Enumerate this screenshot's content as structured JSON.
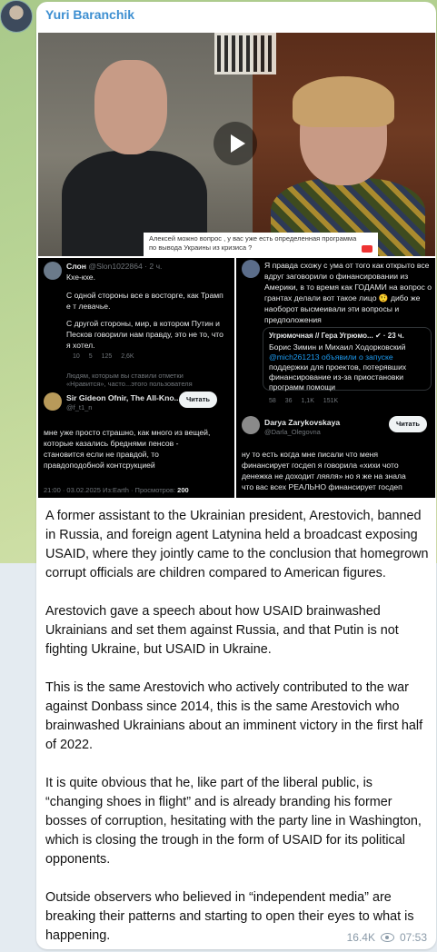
{
  "post": {
    "author": "Yuri Baranchik",
    "views": "16.4K",
    "time": "07:53",
    "paragraphs": [
      "A former assistant to the Ukrainian president, Arestovich, banned in Russia, and foreign agent Latynina held a broadcast exposing USAID, where they jointly came to the conclusion that homegrown corrupt officials are children compared to American figures.",
      "Arestovich gave a speech about how USAID brainwashed Ukrainians and set them against Russia, and that Putin is not fighting Ukraine, but USAID in Ukraine.",
      "This is the same Arestovich who actively contributed to the war against Donbass since 2014, this is the same Arestovich who brainwashed Ukrainians about an imminent victory in the first half of 2022.",
      "It is quite obvious that he, like part of the liberal public, is “changing shoes in flight” and is already branding his former bosses of corruption, hesitating with the party line in Washington, which is closing the trough in the form of USAID for its political opponents.",
      "Outside observers who believed in “independent media” are breaking their patterns and starting to open their eyes to what is happening."
    ]
  },
  "video": {
    "caption_line1": "Алексей можно вопрос , у вас уже есть определенная программа",
    "caption_line2": "по вывода Украины из кризиса ?"
  },
  "shot_left": {
    "name": "Слон",
    "handle": "@Slon1022864 · 2 ч.",
    "line1": "Кхе-кхе.",
    "line2": "С одной стороны все в восторге, как Трамп",
    "line3": "е     т левачье.",
    "line4": "С другой стороны, мир, в котором Путин и",
    "line5": "Песков говорили нам правду, это не то, что",
    "line6": "я хотел.",
    "stats": "10 5 125 2,6K",
    "liked_note1": "Людям, которым вы ставили отметки",
    "liked_note2": "«Нравится», часто...этого пользователя",
    "reply_name": "Sir Gideon Ofnir, The All-Kno...",
    "reply_handle": "@f_t1_n",
    "read_button": "Читать",
    "reply1": "мне уже просто страшно, как много из вещей,",
    "reply2": "которые казались бреднями пенсов -",
    "reply3": "становится если не правдой, то",
    "reply4": "правдоподобной контсрукцией",
    "footer_time": "21:00 · 03.02.2025 Из:Earth · Просмотров:",
    "footer_views": "200"
  },
  "shot_right": {
    "line1": "Я правда схожу с ума от того как открыто все",
    "line2": "вдруг заговорили о финансировании из",
    "line3": "Америки, в то время как ГОДАМИ на вопрос о",
    "line4": "грантах делали вот такое лицо 🤨 дибо же",
    "line5": "наоборот высмеивали эти вопросы и",
    "line6": "предположения",
    "quote_name": "Угрюмочная // Гера Угрюмо... ✔ · 23 ч.",
    "quote1": "Борис Зимин и Михаил Ходорковский",
    "quote2": "@mich261213 объявили о запуске",
    "quote3": "поддержки для проектов, потерявших",
    "quote4": "финансирование из-за приостановки",
    "quote5": "программ помощи",
    "stats": "58 36 1,1K 151K",
    "reply_name": "Darya Zarykovskaya",
    "reply_handle": "@Darla_Olegovna",
    "read_button": "Читать",
    "reply1": "ну то есть когда мне писали что меня",
    "reply2": "финансирует госдеп я говорила «хихи чото",
    "reply3": "денежка не доходит ляяля» но я же на знала",
    "reply4": "что вас всех РЕАЛЬНО финансирует госдеп"
  },
  "colors": {
    "author": "#3d8fd1",
    "meta": "#8a9aa8",
    "bubble": "#ffffff"
  }
}
